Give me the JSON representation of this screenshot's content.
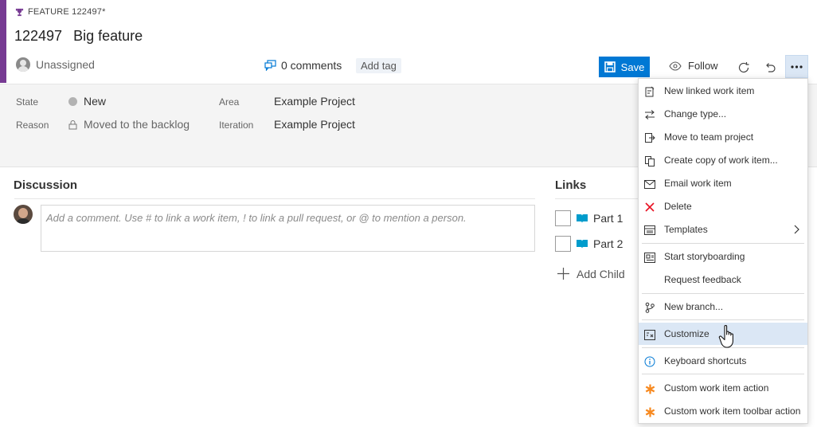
{
  "work_item": {
    "type_label": "FEATURE 122497*",
    "id": "122497",
    "title": "Big feature",
    "assignee": "Unassigned",
    "comments": "0 comments",
    "add_tag": "Add tag"
  },
  "toolbar": {
    "save_label": "Save",
    "follow_label": "Follow",
    "accent_color": "#0078d4"
  },
  "fields": {
    "state_label": "State",
    "state_value": "New",
    "reason_label": "Reason",
    "reason_value": "Moved to the backlog",
    "area_label": "Area",
    "area_value": "Example Project",
    "iteration_label": "Iteration",
    "iteration_value": "Example Project"
  },
  "discussion": {
    "title": "Discussion",
    "placeholder": "Add a comment. Use # to link a work item, ! to link a pull request, or @ to mention a person."
  },
  "links": {
    "title": "Links",
    "items": [
      {
        "label": "Part 1"
      },
      {
        "label": "Part 2"
      }
    ],
    "add_child": "Add Child"
  },
  "menu": {
    "items": [
      {
        "label": "New linked work item",
        "icon": "linked-item-icon"
      },
      {
        "label": "Change type...",
        "icon": "change-type-icon"
      },
      {
        "label": "Move to team project",
        "icon": "move-icon"
      },
      {
        "label": "Create copy of work item...",
        "icon": "copy-icon"
      },
      {
        "label": "Email work item",
        "icon": "mail-icon"
      },
      {
        "label": "Delete",
        "icon": "delete-icon"
      },
      {
        "label": "Templates",
        "icon": "templates-icon"
      },
      {
        "label": "Start storyboarding",
        "icon": "storyboard-icon"
      },
      {
        "label": "Request feedback",
        "icon": ""
      },
      {
        "label": "New branch...",
        "icon": "branch-icon"
      },
      {
        "label": "Customize",
        "icon": "customize-icon"
      },
      {
        "label": "Keyboard shortcuts",
        "icon": "info-icon"
      },
      {
        "label": "Custom work item action",
        "icon": "asterisk-icon"
      },
      {
        "label": "Custom work item toolbar action",
        "icon": "asterisk-icon"
      }
    ]
  },
  "colors": {
    "feature_purple": "#773b93",
    "delete_red": "#e81123",
    "custom_orange": "#f7891f",
    "menu_highlight": "#dbe7f5"
  }
}
